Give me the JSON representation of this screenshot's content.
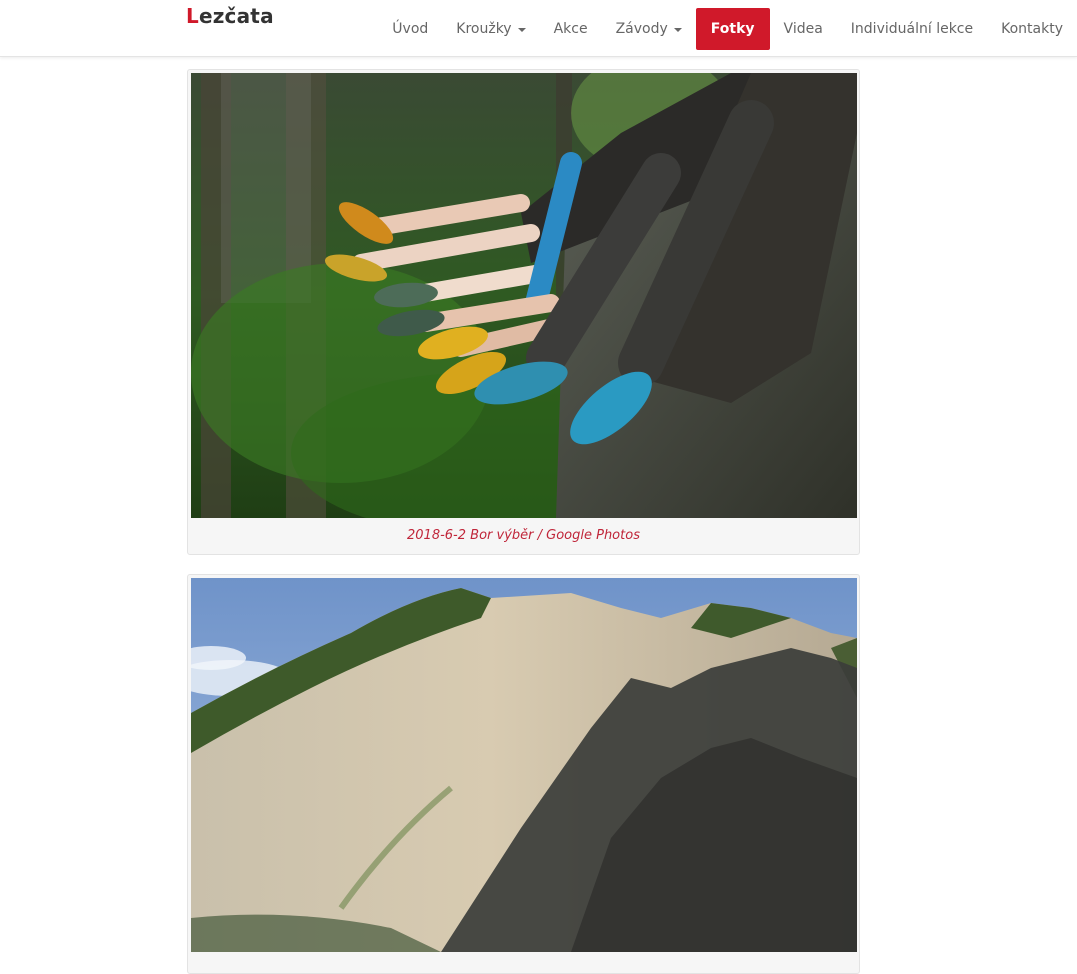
{
  "brand": {
    "first_letter": "L",
    "rest": "ezčata"
  },
  "nav": {
    "items": [
      {
        "label": "Úvod",
        "dropdown": false,
        "active": false
      },
      {
        "label": "Kroužky",
        "dropdown": true,
        "active": false
      },
      {
        "label": "Akce",
        "dropdown": false,
        "active": false
      },
      {
        "label": "Závody",
        "dropdown": true,
        "active": false
      },
      {
        "label": "Fotky",
        "dropdown": false,
        "active": true
      },
      {
        "label": "Videa",
        "dropdown": false,
        "active": false
      },
      {
        "label": "Individuální lekce",
        "dropdown": false,
        "active": false
      },
      {
        "label": "Kontakty",
        "dropdown": false,
        "active": false
      }
    ]
  },
  "gallery": {
    "albums": [
      {
        "caption": "2018-6-2 Bor výběr / Google Photos"
      }
    ]
  },
  "colors": {
    "accent": "#d0192a",
    "caption": "#c0263a",
    "nav_text": "#666666"
  }
}
